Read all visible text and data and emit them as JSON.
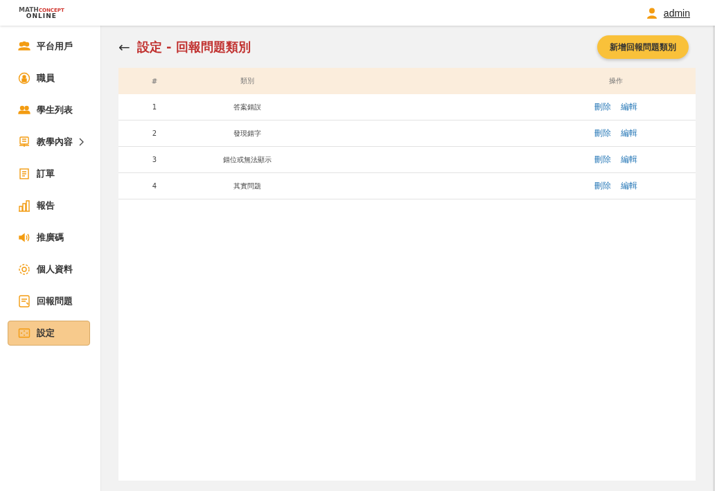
{
  "logo": {
    "line_1a": "MATH",
    "line_1b": "CONCEPT",
    "line_2": "ONLINE"
  },
  "user": {
    "name": "admin"
  },
  "sidebar": {
    "items": [
      {
        "label": "平台用戶",
        "selected": false,
        "has_submenu": false
      },
      {
        "label": "職員",
        "selected": false,
        "has_submenu": false
      },
      {
        "label": "學生列表",
        "selected": false,
        "has_submenu": false
      },
      {
        "label": "教學內容",
        "selected": false,
        "has_submenu": true
      },
      {
        "label": "訂單",
        "selected": false,
        "has_submenu": false
      },
      {
        "label": "報告",
        "selected": false,
        "has_submenu": false
      },
      {
        "label": "推廣碼",
        "selected": false,
        "has_submenu": false
      },
      {
        "label": "個人資料",
        "selected": false,
        "has_submenu": false
      },
      {
        "label": "回報問題",
        "selected": false,
        "has_submenu": false
      },
      {
        "label": "設定",
        "selected": true,
        "has_submenu": false
      }
    ]
  },
  "page": {
    "back": "←",
    "title": "設定 - 回報問題類別",
    "add_button": "新增回報問題類別"
  },
  "table": {
    "columns": [
      "#",
      "類別",
      "操作"
    ],
    "rows": [
      {
        "index": "1",
        "category": "答案錯誤",
        "actions": [
          "刪除",
          "編輯"
        ]
      },
      {
        "index": "2",
        "category": "發現錯字",
        "actions": [
          "刪除",
          "編輯"
        ]
      },
      {
        "index": "3",
        "category": "錯位或無法顯示",
        "actions": [
          "刪除",
          "編輯"
        ]
      },
      {
        "index": "4",
        "category": "其實問題",
        "actions": [
          "刪除",
          "編輯"
        ]
      }
    ]
  }
}
